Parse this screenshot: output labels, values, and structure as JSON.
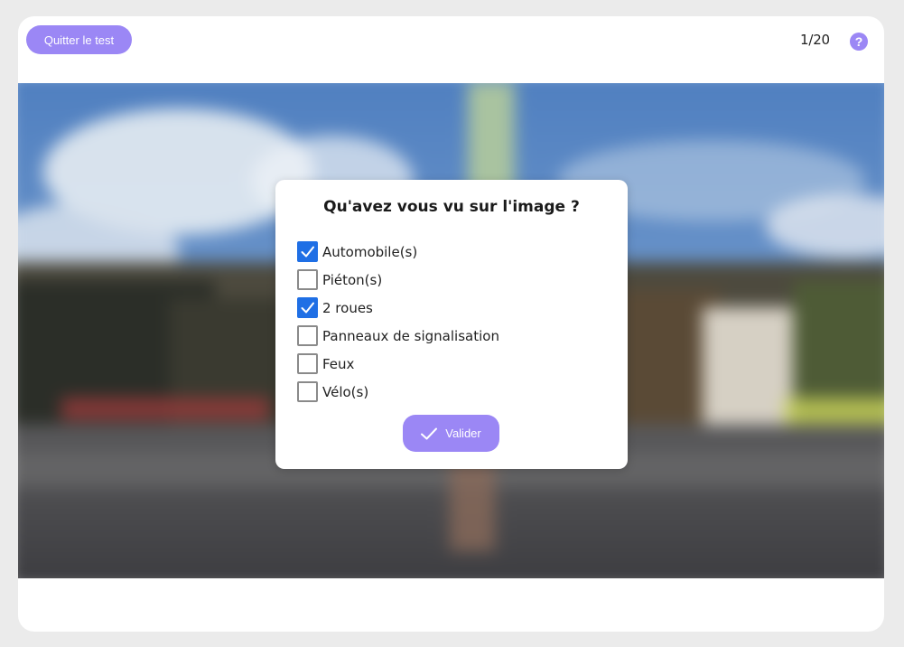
{
  "header": {
    "quit_label": "Quitter le test",
    "progress": "1/20",
    "help_icon": "help-icon"
  },
  "dialog": {
    "title": "Qu'avez vous vu sur l'image ?",
    "options": [
      {
        "label": "Automobile(s)",
        "checked": true
      },
      {
        "label": "Piéton(s)",
        "checked": false
      },
      {
        "label": "2 roues",
        "checked": true
      },
      {
        "label": "Panneaux de signalisation",
        "checked": false
      },
      {
        "label": "Feux",
        "checked": false
      },
      {
        "label": "Vélo(s)",
        "checked": false
      }
    ],
    "submit_label": "Valider",
    "submit_icon": "checkmark-icon"
  },
  "colors": {
    "accent": "#9b87f5",
    "checkbox_checked": "#1f6fe5",
    "background": "#ebebeb"
  }
}
